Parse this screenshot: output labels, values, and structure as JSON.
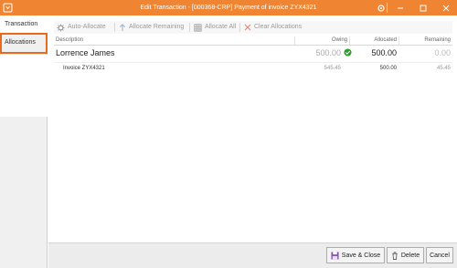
{
  "window": {
    "title": "Edit Transaction - [000368-CRP] Payment of invoice ZYX4321",
    "colors": {
      "title_bar": "#ef8532",
      "highlight": "#e86a1f",
      "success": "#2e9e2e"
    }
  },
  "tabs": [
    {
      "label": "Transaction",
      "active": false
    },
    {
      "label": "Allocations",
      "active": true
    }
  ],
  "toolbar": {
    "auto_allocate": "Auto-Allocate",
    "allocate_remaining": "Allocate Remaining",
    "allocate_all": "Allocate All",
    "clear_allocations": "Clear Allocations"
  },
  "grid": {
    "columns": {
      "description": "Description",
      "owing": "Owing",
      "allocated": "Allocated",
      "remaining": "Remaining"
    },
    "group": {
      "description": "Lorrence James",
      "owing": "500.00",
      "allocated": "500.00",
      "remaining": "0.00",
      "status_icon": "check-circle-icon"
    },
    "rows": [
      {
        "description": "Invoice ZYX4321",
        "owing": "545.45",
        "allocated": "500.00",
        "remaining": "45.45"
      }
    ]
  },
  "footer": {
    "save_close": "Save & Close",
    "delete": "Delete",
    "cancel": "Cancel"
  }
}
